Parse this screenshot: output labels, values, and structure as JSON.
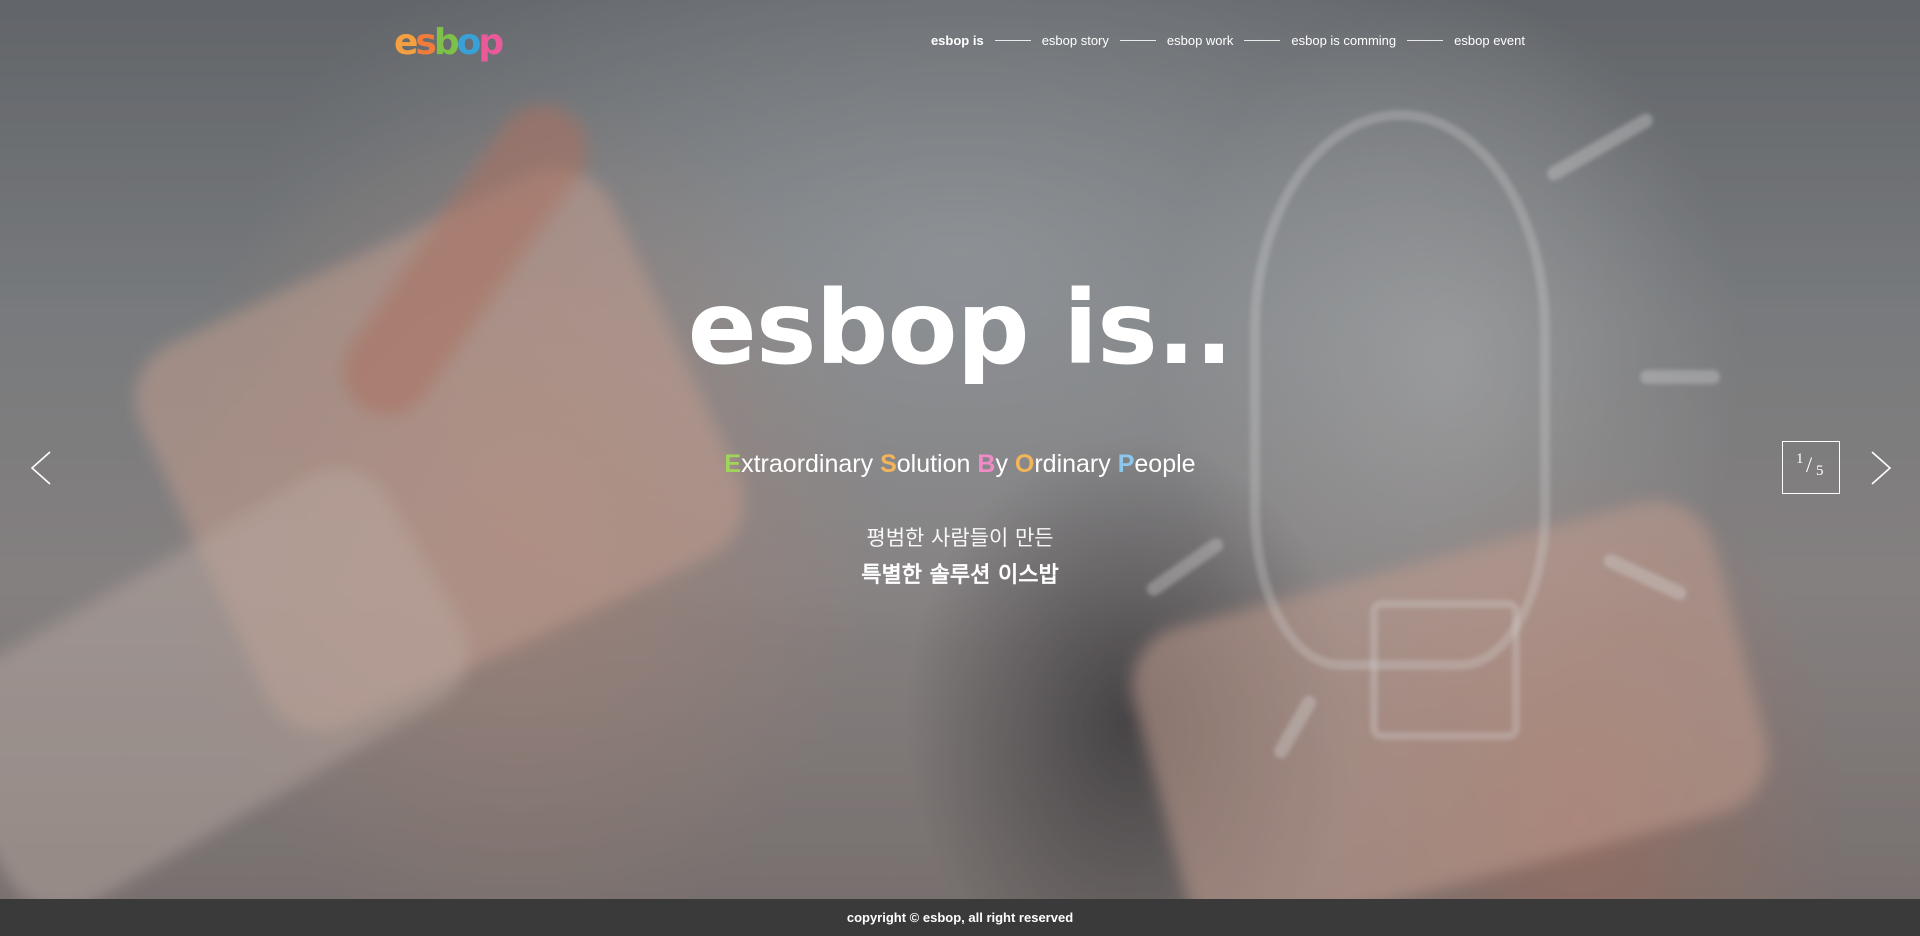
{
  "header": {
    "logo": {
      "letters": [
        "e",
        "s",
        "b",
        "o",
        "p"
      ],
      "colors": [
        "#f5a040",
        "#f07c3c",
        "#7fc04a",
        "#3aa0d8",
        "#e85a9a"
      ]
    },
    "nav": [
      {
        "label": "esbop is",
        "active": true
      },
      {
        "label": "esbop story",
        "active": false
      },
      {
        "label": "esbop work",
        "active": false
      },
      {
        "label": "esbop is comming",
        "active": false
      },
      {
        "label": "esbop event",
        "active": false
      }
    ]
  },
  "hero": {
    "title": "esbop is..",
    "tagline": [
      {
        "initial": "E",
        "rest": "xtraordinary",
        "color": "#9fd65a"
      },
      {
        "initial": "S",
        "rest": "olution",
        "color": "#f3b55a"
      },
      {
        "initial": "B",
        "rest": "y",
        "color": "#f08ac8"
      },
      {
        "initial": "O",
        "rest": "rdinary",
        "color": "#f3b55a"
      },
      {
        "initial": "P",
        "rest": "eople",
        "color": "#8cc8ee"
      }
    ],
    "korean_line1": "평범한 사람들이 만든",
    "korean_line2": "특별한 솔루션 이스밥",
    "prev_icon": "chevron-left-icon",
    "next_icon": "chevron-right-icon"
  },
  "slider": {
    "current": "1",
    "separator": "/",
    "total": "5"
  },
  "footer": {
    "copyright": "copyright © esbop, all right reserved"
  }
}
